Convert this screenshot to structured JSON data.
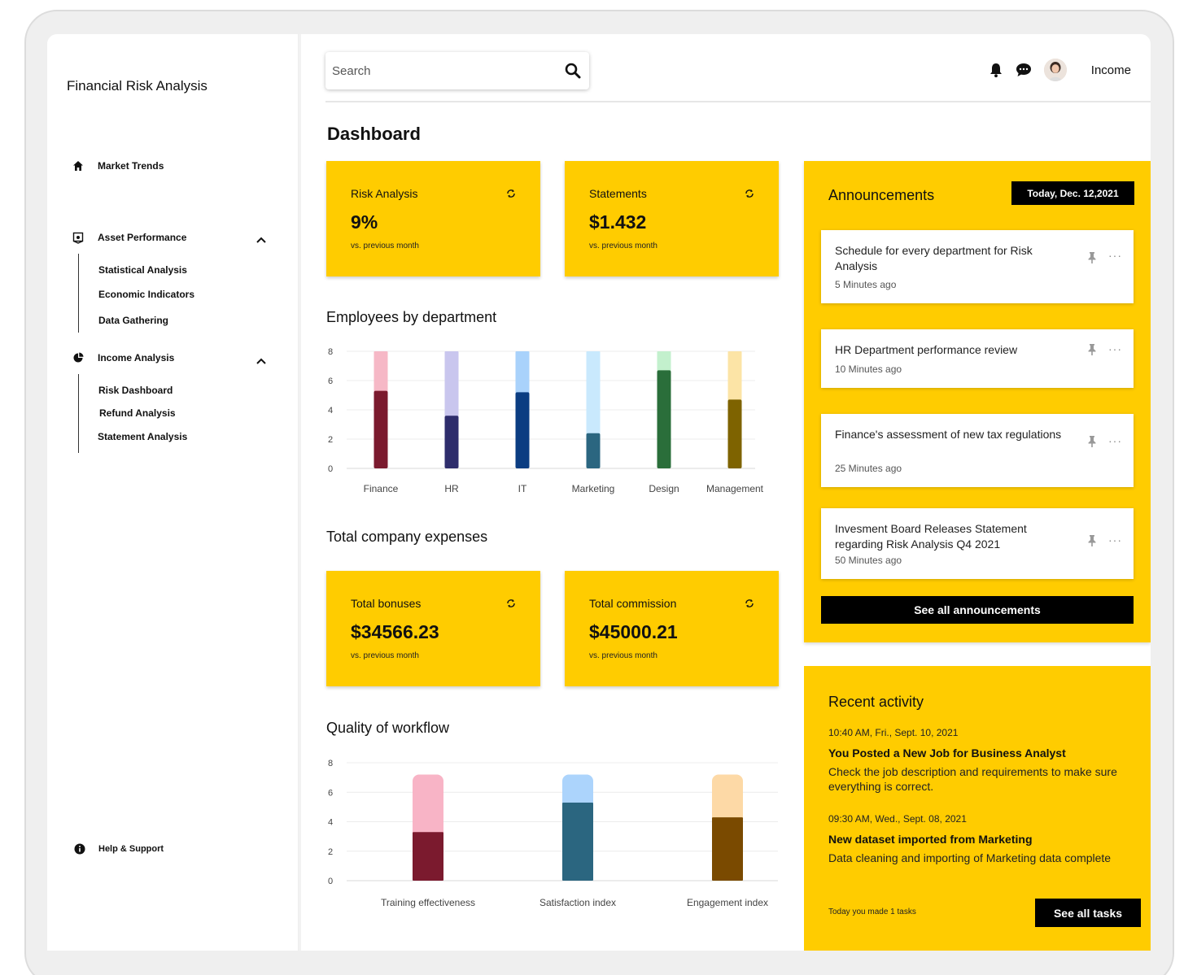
{
  "sidebar": {
    "brand": "Financial Risk Analysis",
    "market_trends": "Market Trends",
    "asset_performance": {
      "label": "Asset Performance",
      "items": [
        "Statistical Analysis",
        "Economic Indicators",
        "Data Gathering"
      ]
    },
    "income_analysis": {
      "label": "Income Analysis",
      "items": [
        "Risk Dashboard",
        "Refund Analysis",
        "Statement Analysis"
      ]
    },
    "help": "Help & Support"
  },
  "header": {
    "search_placeholder": "Search",
    "user_menu": "Income"
  },
  "dashboard": {
    "title": "Dashboard",
    "cards_top": [
      {
        "label": "Risk Analysis",
        "value": "9%",
        "sub": "vs. previous month"
      },
      {
        "label": "Statements",
        "value": "$1.432",
        "sub": "vs. previous month"
      }
    ],
    "employees_title": "Employees by department",
    "expenses_title": "Total company expenses",
    "cards_expenses": [
      {
        "label": "Total bonuses",
        "value": "$34566.23",
        "sub": "vs. previous month"
      },
      {
        "label": "Total commission",
        "value": "$45000.21",
        "sub": "vs. previous month"
      }
    ],
    "workflow_title": "Quality of workflow"
  },
  "chart_data": [
    {
      "type": "bar",
      "title": "Employees by department",
      "categories": [
        "Finance",
        "HR",
        "IT",
        "Marketing",
        "Design",
        "Management"
      ],
      "series": [
        {
          "values": [
            5.3,
            3.6,
            5.2,
            2.4,
            6.7,
            4.7
          ]
        },
        {
          "values": [
            2.7,
            4.4,
            2.8,
            5.6,
            1.3,
            3.3
          ]
        }
      ],
      "stacked": true,
      "ylim": [
        0,
        8
      ],
      "yticks": [
        0,
        2,
        4,
        6,
        8
      ],
      "grid": true,
      "colors": {
        "dark": [
          "#7b1a2e",
          "#2e2d6c",
          "#0b3d82",
          "#2b6680",
          "#2a6e3a",
          "#7e6300"
        ],
        "light": [
          "#f6b8c6",
          "#c9c6ee",
          "#a9d2fb",
          "#c9e9fd",
          "#c3f0cd",
          "#fce4a6"
        ]
      }
    },
    {
      "type": "bar",
      "title": "Quality of workflow",
      "categories": [
        "Training effectiveness",
        "Satisfaction index",
        "Engagement index"
      ],
      "series": [
        {
          "values": [
            3.3,
            5.3,
            4.3
          ]
        },
        {
          "values": [
            3.9,
            1.9,
            2.9
          ]
        }
      ],
      "stacked": true,
      "ylim": [
        0,
        8
      ],
      "yticks": [
        0,
        2,
        4,
        6,
        8
      ],
      "grid": true,
      "colors": {
        "dark": [
          "#7b1a2e",
          "#2b6680",
          "#7a4a00"
        ],
        "light": [
          "#f8b4c6",
          "#acd4fc",
          "#fdd9a6"
        ]
      }
    }
  ],
  "announcements": {
    "title": "Announcements",
    "date": "Today, Dec. 12,2021",
    "items": [
      {
        "title": "Schedule for every department for Risk Analysis",
        "time": "5 Minutes ago"
      },
      {
        "title": "HR Department performance review",
        "time": "10 Minutes ago"
      },
      {
        "title": "Finance's assessment of new tax regulations",
        "time": "25 Minutes ago"
      },
      {
        "title": "Invesment Board Releases Statement regarding Risk Analysis Q4 2021",
        "time": "50 Minutes ago"
      }
    ],
    "see_all": "See all announcements"
  },
  "activity": {
    "title": "Recent activity",
    "items": [
      {
        "when": "10:40 AM, Fri., Sept. 10, 2021",
        "head": "You Posted a New Job for Business Analyst",
        "body": "Check the job description and requirements to make sure everything is correct."
      },
      {
        "when": "09:30 AM, Wed., Sept. 08, 2021",
        "head": "New dataset imported from Marketing",
        "body": "Data cleaning and importing of Marketing data complete"
      }
    ],
    "tasks_note": "Today you made 1 tasks",
    "see_all": "See all tasks"
  }
}
